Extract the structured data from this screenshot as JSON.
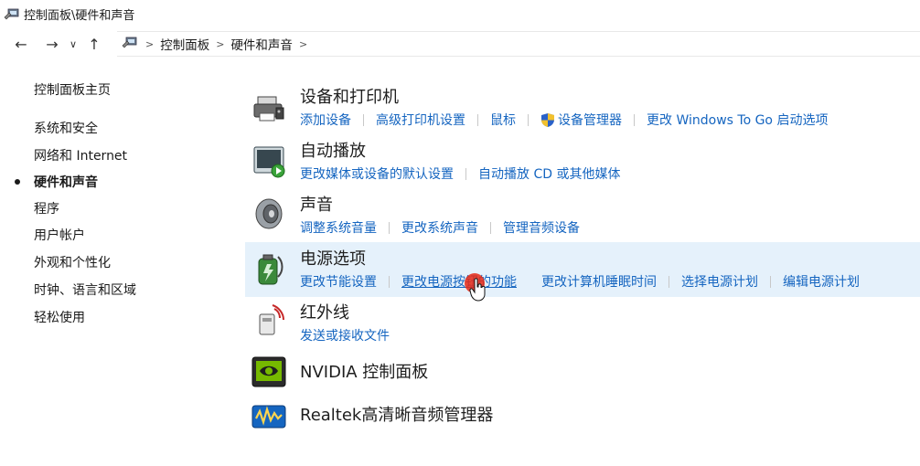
{
  "window": {
    "title": "控制面板\\硬件和声音"
  },
  "address_bar": {
    "crumbs": [
      "控制面板",
      "硬件和声音"
    ]
  },
  "left_nav": {
    "home": "控制面板主页",
    "items": [
      {
        "label": "系统和安全",
        "active": false
      },
      {
        "label": "网络和 Internet",
        "active": false
      },
      {
        "label": "硬件和声音",
        "active": true
      },
      {
        "label": "程序",
        "active": false
      },
      {
        "label": "用户帐户",
        "active": false
      },
      {
        "label": "外观和个性化",
        "active": false
      },
      {
        "label": "时钟、语言和区域",
        "active": false
      },
      {
        "label": "轻松使用",
        "active": false
      }
    ]
  },
  "categories": [
    {
      "title": "设备和打印机",
      "icon": "printer-icon",
      "links": [
        "添加设备",
        "高级打印机设置",
        "鼠标",
        "设备管理器",
        "更改 Windows To Go 启动选项"
      ]
    },
    {
      "title": "自动播放",
      "icon": "autoplay-icon",
      "links": [
        "更改媒体或设备的默认设置",
        "自动播放 CD 或其他媒体"
      ]
    },
    {
      "title": "声音",
      "icon": "speaker-icon",
      "links": [
        "调整系统音量",
        "更改系统声音",
        "管理音频设备"
      ]
    },
    {
      "title": "电源选项",
      "icon": "battery-icon",
      "links": [
        "更改节能设置",
        "更改电源按钮的功能",
        "更改计算机睡眠时间",
        "选择电源计划",
        "编辑电源计划"
      ]
    },
    {
      "title": "红外线",
      "icon": "infrared-icon",
      "links": [
        "发送或接收文件"
      ]
    },
    {
      "title": "NVIDIA 控制面板",
      "icon": "nvidia-icon",
      "links": []
    },
    {
      "title": "Realtek高清晰音频管理器",
      "icon": "realtek-icon",
      "links": []
    }
  ],
  "colors": {
    "link": "#1565c0",
    "highlight": "#e5f1fb"
  }
}
